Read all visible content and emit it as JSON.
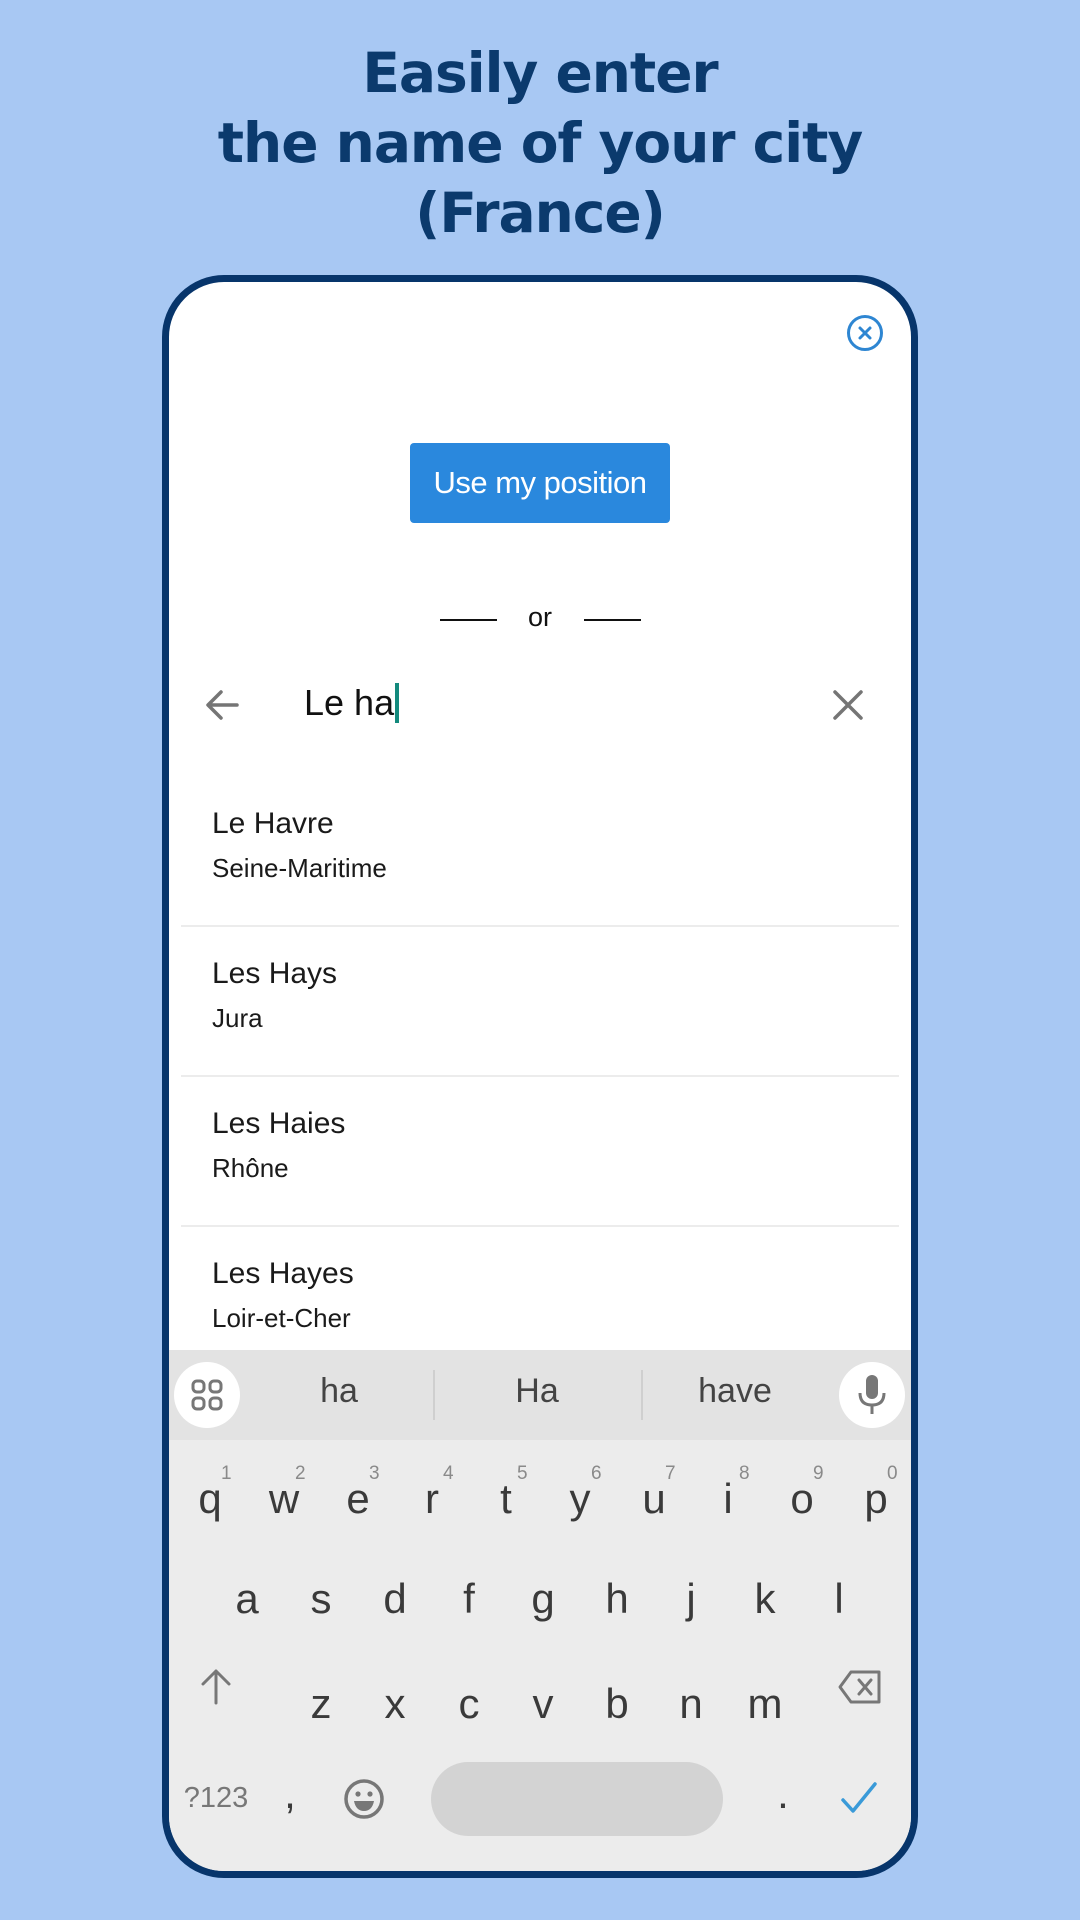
{
  "headline": {
    "lines": [
      "Easily enter",
      "the name of your city",
      "(France)"
    ],
    "color": "#0b3a6d"
  },
  "background_color": "#a8c8f3",
  "dialog": {
    "close_icon": "close-circle-icon",
    "use_position_label": "Use my position",
    "accent_color": "#2a88dd",
    "separator_text": "or"
  },
  "search": {
    "back_icon": "arrow-left-icon",
    "value": "Le ha",
    "clear_icon": "close-icon",
    "caret_color": "#138a7d"
  },
  "results": [
    {
      "city": "Le Havre",
      "department": "Seine-Maritime"
    },
    {
      "city": "Les Hays",
      "department": "Jura"
    },
    {
      "city": "Les Haies",
      "department": "Rhône"
    },
    {
      "city": "Les Hayes",
      "department": "Loir-et-Cher"
    }
  ],
  "keyboard": {
    "suggestions": [
      "ha",
      "Ha",
      "have"
    ],
    "apps_icon": "grid-icon",
    "mic_icon": "microphone-icon",
    "row1": [
      "q",
      "w",
      "e",
      "r",
      "t",
      "y",
      "u",
      "i",
      "o",
      "p"
    ],
    "row1_hints": [
      "1",
      "2",
      "3",
      "4",
      "5",
      "6",
      "7",
      "8",
      "9",
      "0"
    ],
    "row2": [
      "a",
      "s",
      "d",
      "f",
      "g",
      "h",
      "j",
      "k",
      "l"
    ],
    "row3": [
      "z",
      "x",
      "c",
      "v",
      "b",
      "n",
      "m"
    ],
    "shift_icon": "shift-arrow-icon",
    "backspace_icon": "backspace-icon",
    "symbols_label": "?123",
    "comma_label": ",",
    "emoji_icon": "emoji-icon",
    "period_label": ".",
    "enter_icon": "checkmark-icon",
    "enter_color": "#3a9ad8"
  }
}
